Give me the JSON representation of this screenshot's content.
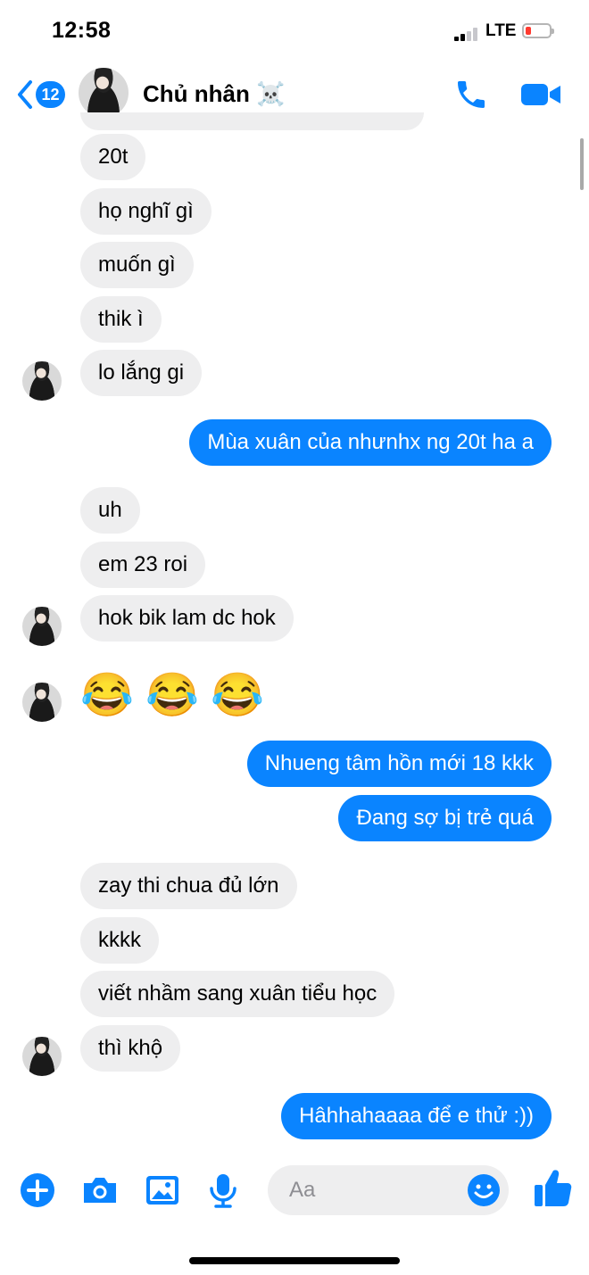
{
  "status_bar": {
    "time": "12:58",
    "network": "LTE"
  },
  "header": {
    "back_count": "12",
    "contact_name": "Chủ nhân ☠️"
  },
  "messages": {
    "m1": "20t",
    "m2": "họ nghĩ gì",
    "m3": "muốn gì",
    "m4": "thik ì",
    "m5": "lo lắng gi",
    "m6": "Mùa xuân của nhưnhx ng 20t ha a",
    "m7": "uh",
    "m8": "em 23 roi",
    "m9": "hok bik lam dc hok",
    "m10": "😂 😂 😂",
    "m11": "Nhueng tâm hồn mới 18 kkk",
    "m12": "Đang sợ bị trẻ quá",
    "m13": "zay thi chua đủ lớn",
    "m14": "kkkk",
    "m15": "viết nhầm sang xuân tiểu học",
    "m16": "thì khộ",
    "m17": "Hâhhahaaaa để e thử :))"
  },
  "composer": {
    "placeholder": "Aa"
  },
  "icons": {
    "back": "chevron-left-icon",
    "phone": "phone-icon",
    "video": "video-camera-icon",
    "plus": "plus-circle-icon",
    "camera": "camera-icon",
    "photo": "photo-icon",
    "mic": "microphone-icon",
    "emoji": "smiley-icon",
    "like": "thumbs-up-icon"
  },
  "colors": {
    "accent": "#0a84ff",
    "incoming_bubble": "#eeeeef",
    "battery_low": "#ff3b30"
  }
}
